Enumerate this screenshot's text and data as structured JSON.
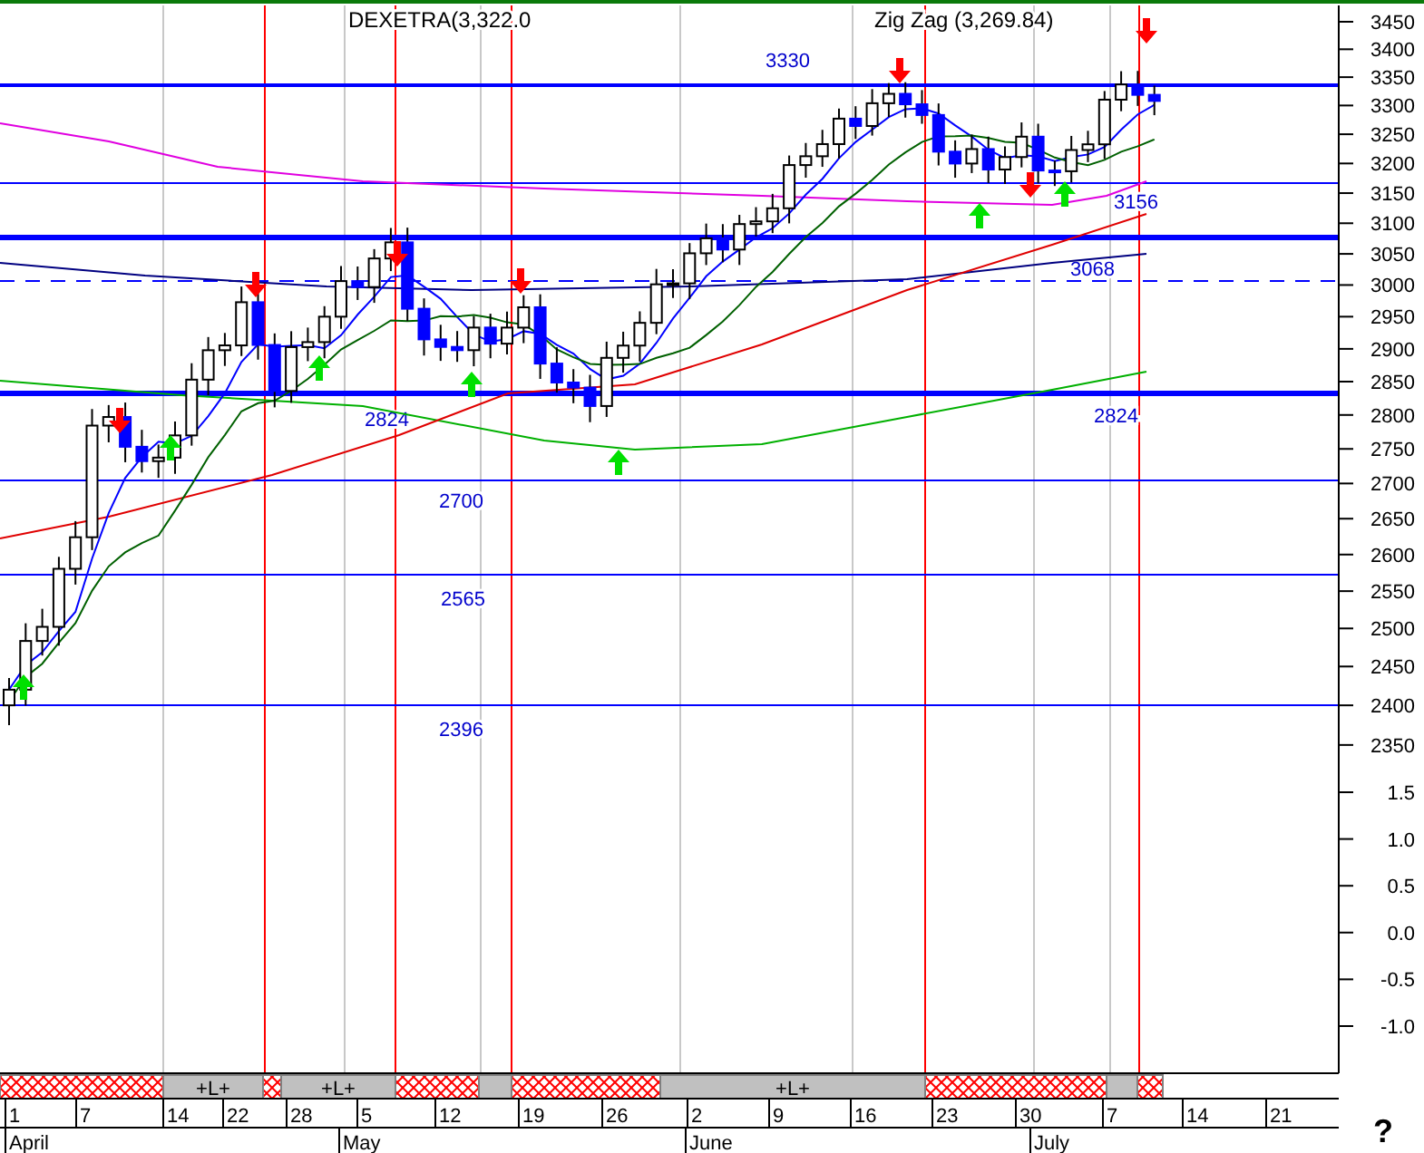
{
  "title": {
    "symbol": "DEXETRA(3,322.0",
    "indicator": "Zig Zag (3,269.84)"
  },
  "price_axis": [
    "3450",
    "3400",
    "3350",
    "3300",
    "3250",
    "3200",
    "3150",
    "3100",
    "3050",
    "3000",
    "2950",
    "2900",
    "2850",
    "2800",
    "2750",
    "2700",
    "2650",
    "2600",
    "2550",
    "2500",
    "2450",
    "2400",
    "2350"
  ],
  "indicator_axis": [
    "1.5",
    "1.0",
    "0.5",
    "0.0",
    "-0.5",
    "-1.0"
  ],
  "levels": [
    {
      "kind": "medium",
      "labels": [
        "3330"
      ]
    },
    {
      "kind": "thin",
      "labels": [
        "3156"
      ]
    },
    {
      "kind": "thick",
      "labels": [
        "3068"
      ]
    },
    {
      "kind": "dashed"
    },
    {
      "kind": "thick",
      "labels": [
        "2824",
        "2824"
      ]
    },
    {
      "kind": "thin",
      "labels": [
        "2700"
      ]
    },
    {
      "kind": "thin",
      "labels": [
        "2565"
      ]
    },
    {
      "kind": "thin",
      "labels": [
        "2396"
      ]
    }
  ],
  "signals": [
    {
      "kind": "buy"
    },
    {
      "kind": "sell"
    },
    {
      "kind": "buy"
    },
    {
      "kind": "sell"
    },
    {
      "kind": "buy"
    },
    {
      "kind": "sell"
    },
    {
      "kind": "buy"
    },
    {
      "kind": "sell"
    },
    {
      "kind": "buy"
    },
    {
      "kind": "sell"
    },
    {
      "kind": "buy"
    },
    {
      "kind": "sell"
    },
    {
      "kind": "buy"
    },
    {
      "kind": "sell"
    }
  ],
  "band": [
    {
      "kind": "hatched"
    },
    {
      "kind": "plain",
      "label": "+L+"
    },
    {
      "kind": "hatched"
    },
    {
      "kind": "plain",
      "label": "+L+"
    },
    {
      "kind": "hatched"
    },
    {
      "kind": "plain"
    },
    {
      "kind": "hatched"
    },
    {
      "kind": "plain",
      "label": "+L+"
    },
    {
      "kind": "hatched"
    },
    {
      "kind": "plain"
    },
    {
      "kind": "hatched"
    }
  ],
  "days": [
    "1",
    "7",
    "14",
    "22",
    "28",
    "5",
    "12",
    "19",
    "26",
    "2",
    "9",
    "16",
    "23",
    "30",
    "7",
    "14",
    "21"
  ],
  "months": [
    "April",
    "May",
    "June",
    "July"
  ],
  "corner_mark": "?"
}
